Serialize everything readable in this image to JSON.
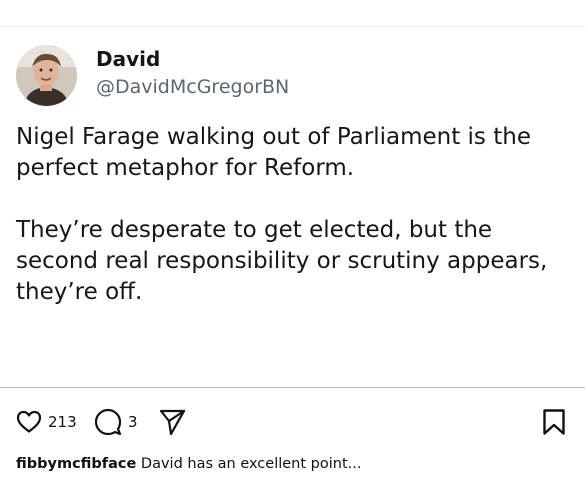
{
  "tweet": {
    "name": "David",
    "handle": "@DavidMcGregorBN",
    "paragraphs": [
      "Nigel Farage walking out of Parliament is the perfect metaphor for Reform.",
      "They’re desperate to get elected, but the second real responsibility or scrutiny appears, they’re off."
    ]
  },
  "actions": {
    "like_icon": "heart-icon",
    "like_count": "213",
    "comment_icon": "comment-icon",
    "comment_count": "3",
    "share_icon": "send-icon",
    "save_icon": "bookmark-icon"
  },
  "caption": {
    "username": "fibbymcfibface",
    "text": "David has an excellent point..."
  }
}
